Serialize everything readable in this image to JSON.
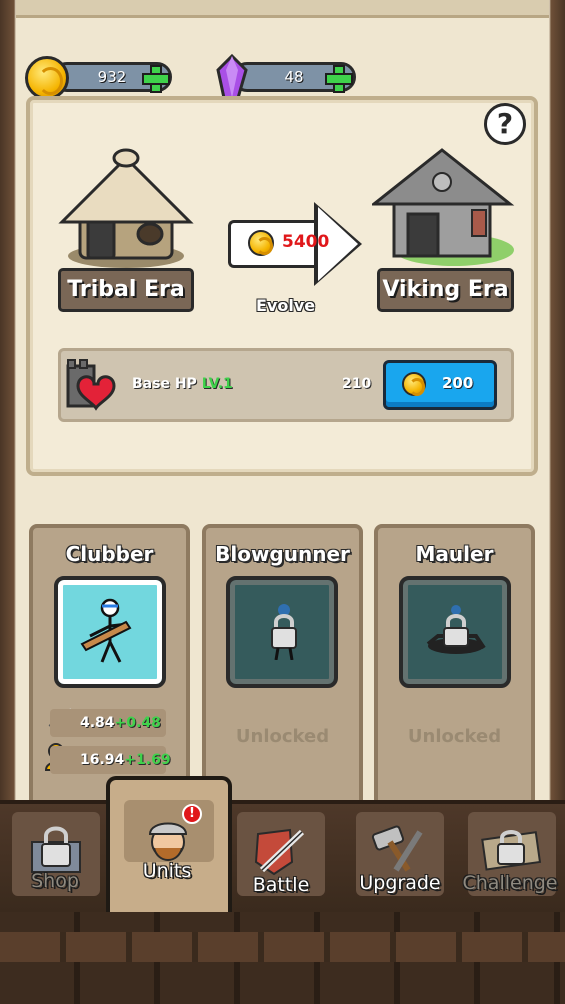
{
  "currency": {
    "gold": "932",
    "gems": "48",
    "gold_icon": "gold-coin-icon",
    "gem_icon": "purple-crystal-icon"
  },
  "evolution": {
    "current_era": "Tribal Era",
    "next_era": "Viking Era",
    "cost": "5400",
    "action_label": "Evolve"
  },
  "base_hp": {
    "label": "Base HP",
    "level": "LV.1",
    "value": "210",
    "upgrade_cost": "200"
  },
  "units": [
    {
      "name": "Clubber",
      "locked": false,
      "attack": "4.84",
      "attack_plus": "+0.48",
      "hp": "16.94",
      "hp_plus": "+1.69"
    },
    {
      "name": "Blowgunner",
      "locked": true,
      "status": "Unlocked"
    },
    {
      "name": "Mauler",
      "locked": true,
      "status": "Unlocked"
    }
  ],
  "nav": {
    "shop": "Shop",
    "units": "Units",
    "battle": "Battle",
    "upgrade": "Upgrade",
    "challenge": "Challenge",
    "alert_mark": "!"
  },
  "colors": {
    "accent_blue": "#19a6ee",
    "gold": "#f5b400",
    "plus_green": "#3fd24b",
    "cost_red": "#e0171a"
  }
}
